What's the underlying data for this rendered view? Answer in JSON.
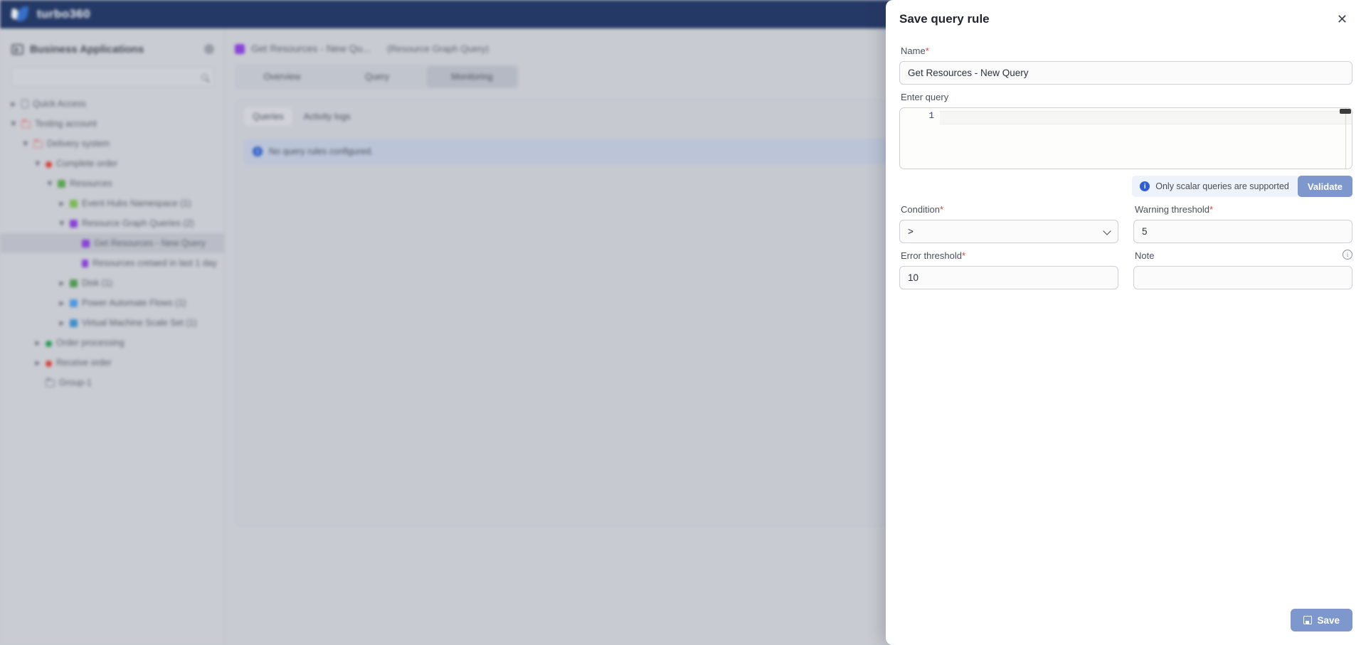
{
  "topbar": {
    "brand": "turbo360",
    "logo_icon": "turbo360-logo-icon"
  },
  "sidebar": {
    "title": "Business Applications",
    "header_icon": "business-applications-icon",
    "settings_icon": "gear-icon",
    "search": {
      "value": "",
      "placeholder": "",
      "icon": "search-icon"
    },
    "items": [
      {
        "label": "Quick Access",
        "indent": 0,
        "caret": "collapsed",
        "icon": "bookmark-icon",
        "color": "#7c818c",
        "selected": false
      },
      {
        "label": "Testing account",
        "indent": 0,
        "caret": "expanded",
        "icon": "folder-icon",
        "color": "#e07a7a",
        "selected": false
      },
      {
        "label": "Delivery system",
        "indent": 1,
        "caret": "expanded",
        "icon": "folder-icon",
        "color": "#e07a7a",
        "selected": false
      },
      {
        "label": "Complete order",
        "indent": 2,
        "caret": "expanded",
        "icon": "status-dot-icon",
        "color": "#e03b30",
        "selected": false
      },
      {
        "label": "Resources",
        "indent": 3,
        "caret": "expanded",
        "icon": "resource-group-icon",
        "color": "#5aa84f",
        "selected": false
      },
      {
        "label": "Event Hubs Namespace (1)",
        "indent": 4,
        "caret": "collapsed",
        "icon": "event-hubs-icon",
        "color": "#7dbf4f",
        "selected": false
      },
      {
        "label": "Resource Graph Queries (2)",
        "indent": 4,
        "caret": "expanded",
        "icon": "resource-graph-query-icon",
        "color": "#8b3de0",
        "selected": false
      },
      {
        "label": "Get Resources - New Query",
        "indent": 5,
        "caret": "none",
        "icon": "resource-graph-query-icon",
        "color": "#8b3de0",
        "selected": true
      },
      {
        "label": "Resources cretaed in last 1 day",
        "indent": 5,
        "caret": "none",
        "icon": "resource-graph-query-icon",
        "color": "#8b3de0",
        "selected": false
      },
      {
        "label": "Disk (1)",
        "indent": 4,
        "caret": "collapsed",
        "icon": "disk-icon",
        "color": "#4f9c50",
        "selected": false
      },
      {
        "label": "Power Automate Flows (1)",
        "indent": 4,
        "caret": "collapsed",
        "icon": "power-automate-icon",
        "color": "#4a9ae8",
        "selected": false
      },
      {
        "label": "Virtual Machine Scale Set (1)",
        "indent": 4,
        "caret": "collapsed",
        "icon": "vm-scale-set-icon",
        "color": "#3b8fd6",
        "selected": false
      },
      {
        "label": "Order processing",
        "indent": 2,
        "caret": "collapsed",
        "icon": "status-dot-icon",
        "color": "#16a04d",
        "selected": false
      },
      {
        "label": "Receive order",
        "indent": 2,
        "caret": "collapsed",
        "icon": "status-dot-icon",
        "color": "#e03b30",
        "selected": false
      },
      {
        "label": "Group-1",
        "indent": 2,
        "caret": "none",
        "icon": "folder-icon-grey",
        "color": "#7c818c",
        "selected": false
      }
    ],
    "collapse_icon": "chevron-left-icon"
  },
  "main": {
    "page_title": "Get Resources - New Qu...",
    "page_subtitle": "(Resource Graph Query)",
    "page_icon": "resource-graph-query-icon",
    "tabs": [
      {
        "label": "Overview",
        "active": false
      },
      {
        "label": "Query",
        "active": false
      },
      {
        "label": "Monitoring",
        "active": true
      }
    ],
    "subtabs": [
      {
        "label": "Queries",
        "active": true
      },
      {
        "label": "Activity logs",
        "active": false
      }
    ],
    "alert": {
      "icon": "info-icon",
      "text": "No query rules configured."
    }
  },
  "modal": {
    "title": "Save query rule",
    "close_icon": "close-icon",
    "name": {
      "label": "Name",
      "required": true,
      "value": "Get Resources - New Query",
      "placeholder": ""
    },
    "query": {
      "label": "Enter query",
      "line_number": "1",
      "value": "",
      "scrollbar_icon": "scrollbar-thumb"
    },
    "validate": {
      "hint_icon": "info-icon",
      "hint": "Only scalar queries are supported",
      "button_label": "Validate"
    },
    "condition": {
      "label": "Condition",
      "required": true,
      "value": ">",
      "options": [
        ">",
        ">=",
        "<",
        "<=",
        "=",
        "!="
      ],
      "chevron_icon": "chevron-down-icon"
    },
    "warning_threshold": {
      "label": "Warning threshold",
      "required": true,
      "value": "5",
      "placeholder": ""
    },
    "error_threshold": {
      "label": "Error threshold",
      "required": true,
      "value": "10",
      "placeholder": ""
    },
    "note": {
      "label": "Note",
      "required": false,
      "value": "",
      "placeholder": "",
      "info_icon": "info-circle-icon"
    },
    "save": {
      "label": "Save",
      "icon": "save-floppy-icon"
    },
    "accent_color": "#7e97cd",
    "required_color": "#e2453c"
  }
}
